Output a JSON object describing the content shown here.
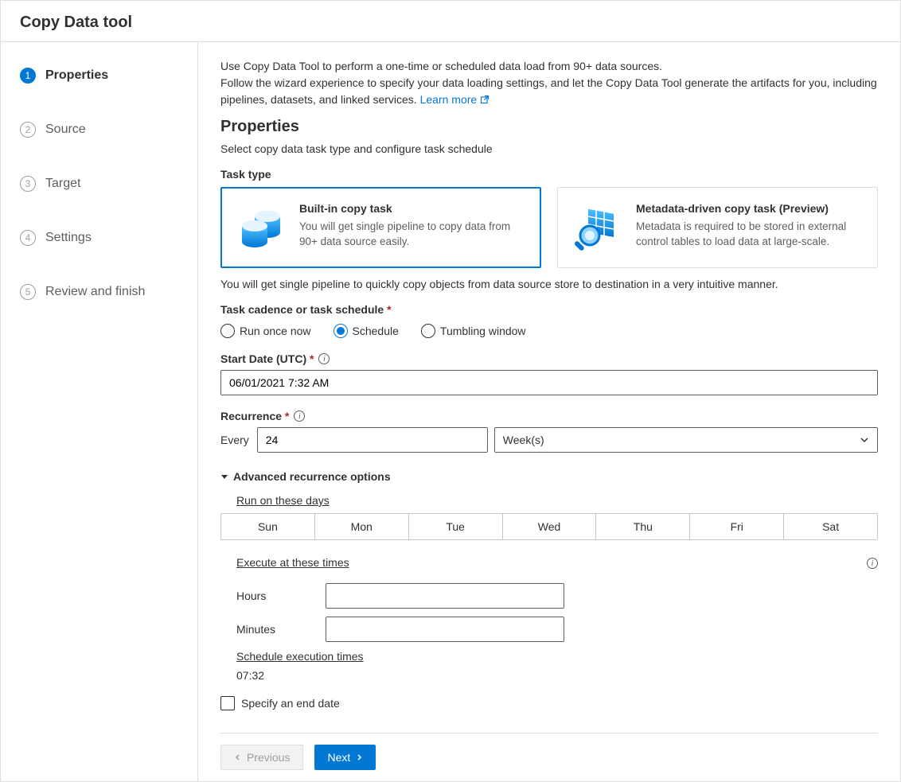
{
  "window": {
    "title": "Copy Data tool"
  },
  "steps": [
    {
      "num": "1",
      "label": "Properties",
      "active": true
    },
    {
      "num": "2",
      "label": "Source",
      "active": false
    },
    {
      "num": "3",
      "label": "Target",
      "active": false
    },
    {
      "num": "4",
      "label": "Settings",
      "active": false
    },
    {
      "num": "5",
      "label": "Review and finish",
      "active": false
    }
  ],
  "intro": {
    "line1": "Use Copy Data Tool to perform a one-time or scheduled data load from 90+ data sources.",
    "line2_a": "Follow the wizard experience to specify your data loading settings, and let the Copy Data Tool generate the artifacts for you, including pipelines, datasets, and linked services. ",
    "learn_more": "Learn more"
  },
  "heading": "Properties",
  "subheading": "Select copy data task type and configure task schedule",
  "task_type_label": "Task type",
  "cards": {
    "builtin": {
      "title": "Built-in copy task",
      "desc": "You will get single pipeline to copy data from 90+ data source easily."
    },
    "metadata": {
      "title": "Metadata-driven copy task (Preview)",
      "desc": "Metadata is required to be stored in external control tables to load data at large-scale."
    }
  },
  "task_hint": "You will get single pipeline to quickly copy objects from data source store to destination in a very intuitive manner.",
  "cadence_label": "Task cadence or task schedule",
  "radios": {
    "once": "Run once now",
    "schedule": "Schedule",
    "tumbling": "Tumbling window",
    "selected": "schedule"
  },
  "start_date_label": "Start Date (UTC)",
  "start_date_value": "06/01/2021 7:32 AM",
  "recurrence_label": "Recurrence",
  "every_label": "Every",
  "every_value": "24",
  "unit_value": "Week(s)",
  "advanced_label": "Advanced recurrence options",
  "run_days_label": "Run on these days",
  "days": [
    "Sun",
    "Mon",
    "Tue",
    "Wed",
    "Thu",
    "Fri",
    "Sat"
  ],
  "exec_label": "Execute at these times",
  "hours_label": "Hours",
  "hours_value": "",
  "minutes_label": "Minutes",
  "minutes_value": "",
  "sched_times_label": "Schedule execution times",
  "sched_times_value": "07:32",
  "end_date_label": "Specify an end date",
  "buttons": {
    "prev": "Previous",
    "next": "Next"
  }
}
